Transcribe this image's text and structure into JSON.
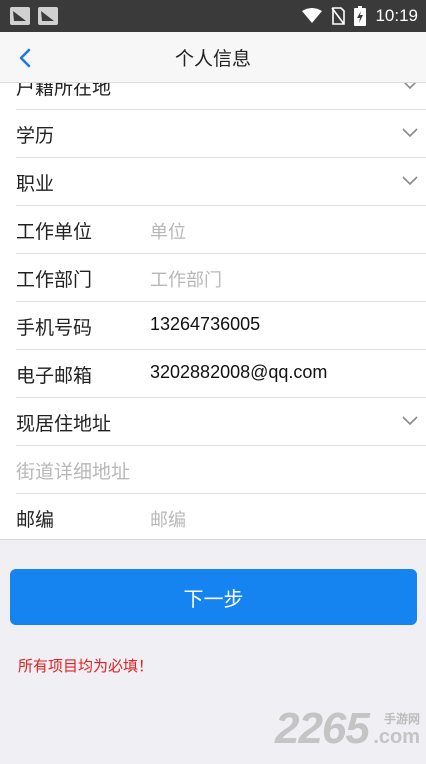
{
  "status_bar": {
    "time": "10:19",
    "icons": [
      "app-notification-icon",
      "app-notification-icon",
      "wifi-icon",
      "no-sim-icon",
      "battery-charging-icon"
    ]
  },
  "header": {
    "title": "个人信息",
    "back_icon": "chevron-left-icon"
  },
  "form": {
    "rows": [
      {
        "label": "户籍所在地",
        "type": "select"
      },
      {
        "label": "学历",
        "type": "select"
      },
      {
        "label": "职业",
        "type": "select"
      },
      {
        "label": "工作单位",
        "placeholder": "单位",
        "type": "input"
      },
      {
        "label": "工作部门",
        "placeholder": "工作部门",
        "type": "input"
      },
      {
        "label": "手机号码",
        "value": "13264736005",
        "type": "input"
      },
      {
        "label": "电子邮箱",
        "value": "3202882008@qq.com",
        "type": "input"
      },
      {
        "label": "现居住地址",
        "type": "select"
      },
      {
        "placeholder": "街道详细地址",
        "type": "input"
      },
      {
        "label": "邮编",
        "placeholder": "邮编",
        "type": "input"
      }
    ]
  },
  "actions": {
    "next_label": "下一步"
  },
  "notice": "所有项目均为必填！",
  "watermark": {
    "number": "2265",
    "suffix_top": "手游网",
    "suffix_bottom": ".com"
  },
  "colors": {
    "accent": "#1583f0",
    "warning": "#e02222",
    "status_bar": "#3a3a3a"
  }
}
